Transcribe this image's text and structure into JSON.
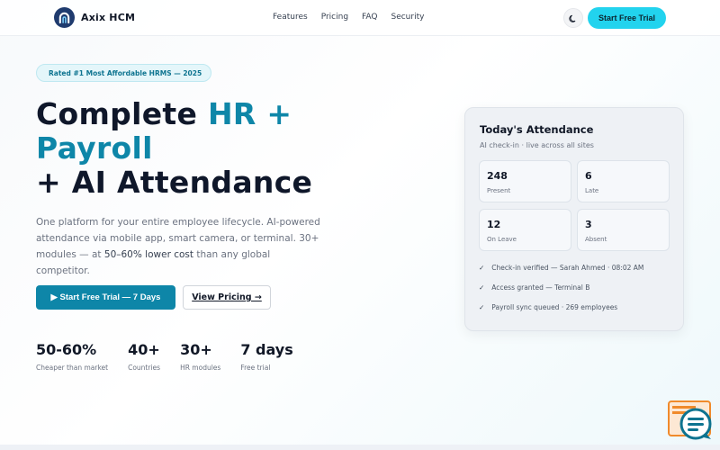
{
  "nav": {
    "brand": "Axix HCM",
    "links": [
      "Features",
      "Pricing",
      "FAQ",
      "Security"
    ],
    "cta": "Start Free Trial"
  },
  "hero": {
    "badge_icon": "",
    "badge_text": "Rated #1 Most Affordable HRMS — 2025",
    "headline_1": "Complete ",
    "headline_accent": "HR +\nPayroll",
    "headline_2": "+ AI Attendance",
    "lead_1": "One platform for your entire employee lifecycle. AI-powered attendance via mobile app, smart camera, or terminal. 30+ modules — at ",
    "lead_bold": "50–60% lower cost",
    "lead_2": " than any global competitor.",
    "primary_cta": "▶ Start Free Trial — 7 Days",
    "secondary_cta": "View Pricing →"
  },
  "stats": [
    {
      "value": "50-60%",
      "label": "Cheaper than market"
    },
    {
      "value": "40+",
      "label": "Countries"
    },
    {
      "value": "30+",
      "label": "HR modules"
    },
    {
      "value": "7 days",
      "label": "Free trial"
    }
  ],
  "attendance": {
    "title": "Today's Attendance",
    "subtitle": "AI check-in · live across all sites",
    "tiles": [
      {
        "value": "248",
        "label": "Present"
      },
      {
        "value": "6",
        "label": "Late"
      },
      {
        "value": "12",
        "label": "On Leave"
      },
      {
        "value": "3",
        "label": "Absent"
      }
    ],
    "log": [
      "Check-in verified — Sarah Ahmed · 08:02 AM",
      "Access granted — Terminal B",
      "Payroll sync queued · 269 employees"
    ]
  },
  "colors": {
    "accent": "#0e86a8",
    "cta_cyan": "#22d3ee",
    "brand_navy": "#1f3b6e",
    "chat_orange": "#f08a2b",
    "chat_teal": "#0e7490"
  },
  "icons": {
    "logo": "arch-logo-icon",
    "theme": "moon-icon",
    "check": "check-icon",
    "chat": "chat-support-icon"
  }
}
